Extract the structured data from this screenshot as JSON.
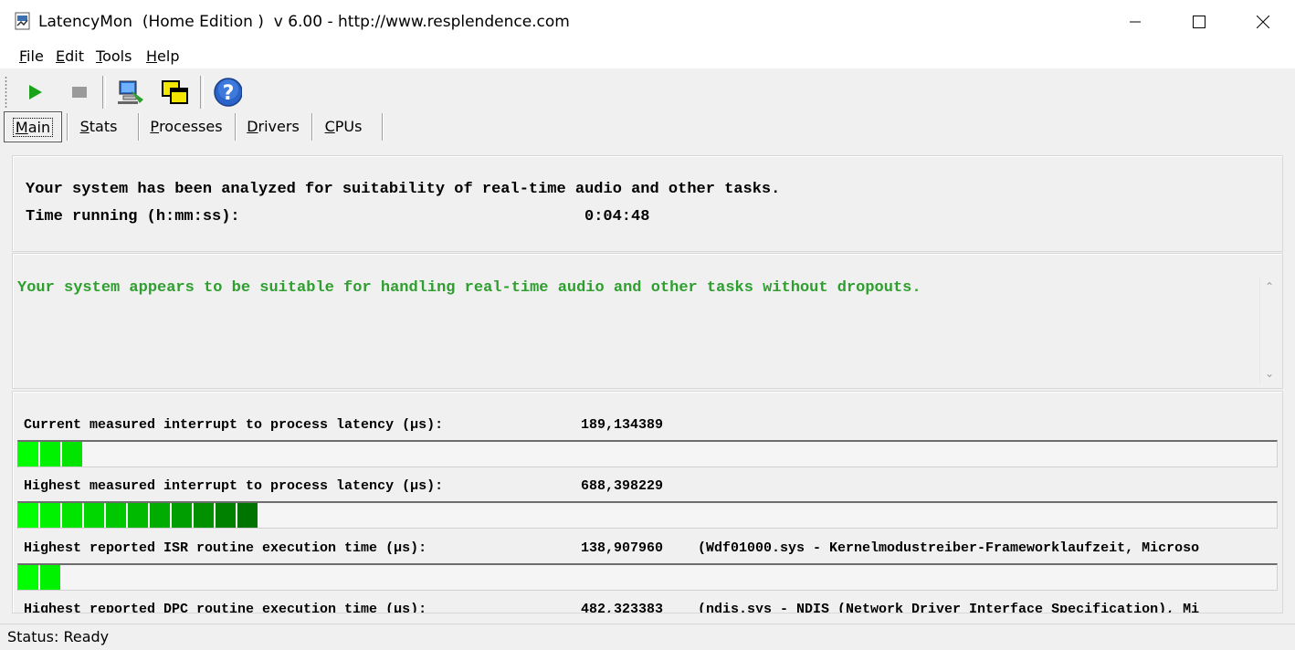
{
  "window": {
    "title": "LatencyMon  (Home Edition )  v 6.00 - http://www.resplendence.com"
  },
  "menu": {
    "file": {
      "accel": "F",
      "rest": "ile"
    },
    "edit": {
      "accel": "E",
      "rest": "dit"
    },
    "tools": {
      "accel": "T",
      "rest": "ools"
    },
    "help": {
      "accel": "H",
      "rest": "elp"
    }
  },
  "toolbar": {
    "icons": [
      "play-icon",
      "stop-icon",
      "analyze-icon",
      "windows-icon",
      "help-icon"
    ]
  },
  "tabs": [
    {
      "accel": "M",
      "rest": "ain",
      "active": true
    },
    {
      "accel": "S",
      "rest": "tats",
      "active": false
    },
    {
      "accel": "P",
      "rest": "rocesses",
      "active": false
    },
    {
      "accel": "D",
      "rest": "rivers",
      "active": false
    },
    {
      "accel": "C",
      "rest": "PUs",
      "active": false
    }
  ],
  "summary": {
    "analyzed_text": "Your system has been analyzed for suitability of real-time audio and other tasks.",
    "time_label": "Time running (h:mm:ss):",
    "time_value": "0:04:48"
  },
  "verdict": {
    "text": "Your system appears to be suitable for handling real-time audio and other tasks without dropouts.",
    "color": "#2e9e2e"
  },
  "metrics": [
    {
      "label": "Current measured interrupt to process latency (µs):",
      "value": "189,134389",
      "extra": "",
      "segments_lit": 3
    },
    {
      "label": "Highest measured interrupt to process latency (µs):",
      "value": "688,398229",
      "extra": "",
      "segments_lit": 11
    },
    {
      "label": "Highest reported ISR routine execution time (µs):",
      "value": "138,907960",
      "extra": "(Wdf01000.sys - Kernelmodustreiber-Frameworklaufzeit, Microso",
      "segments_lit": 2
    },
    {
      "label": "Highest reported DPC routine execution time (µs):",
      "value": "482,323383",
      "extra": "(ndis.sys - NDIS (Network Driver Interface Specification), Mi",
      "segments_lit": 0
    }
  ],
  "status": {
    "text": "Status: Ready"
  }
}
